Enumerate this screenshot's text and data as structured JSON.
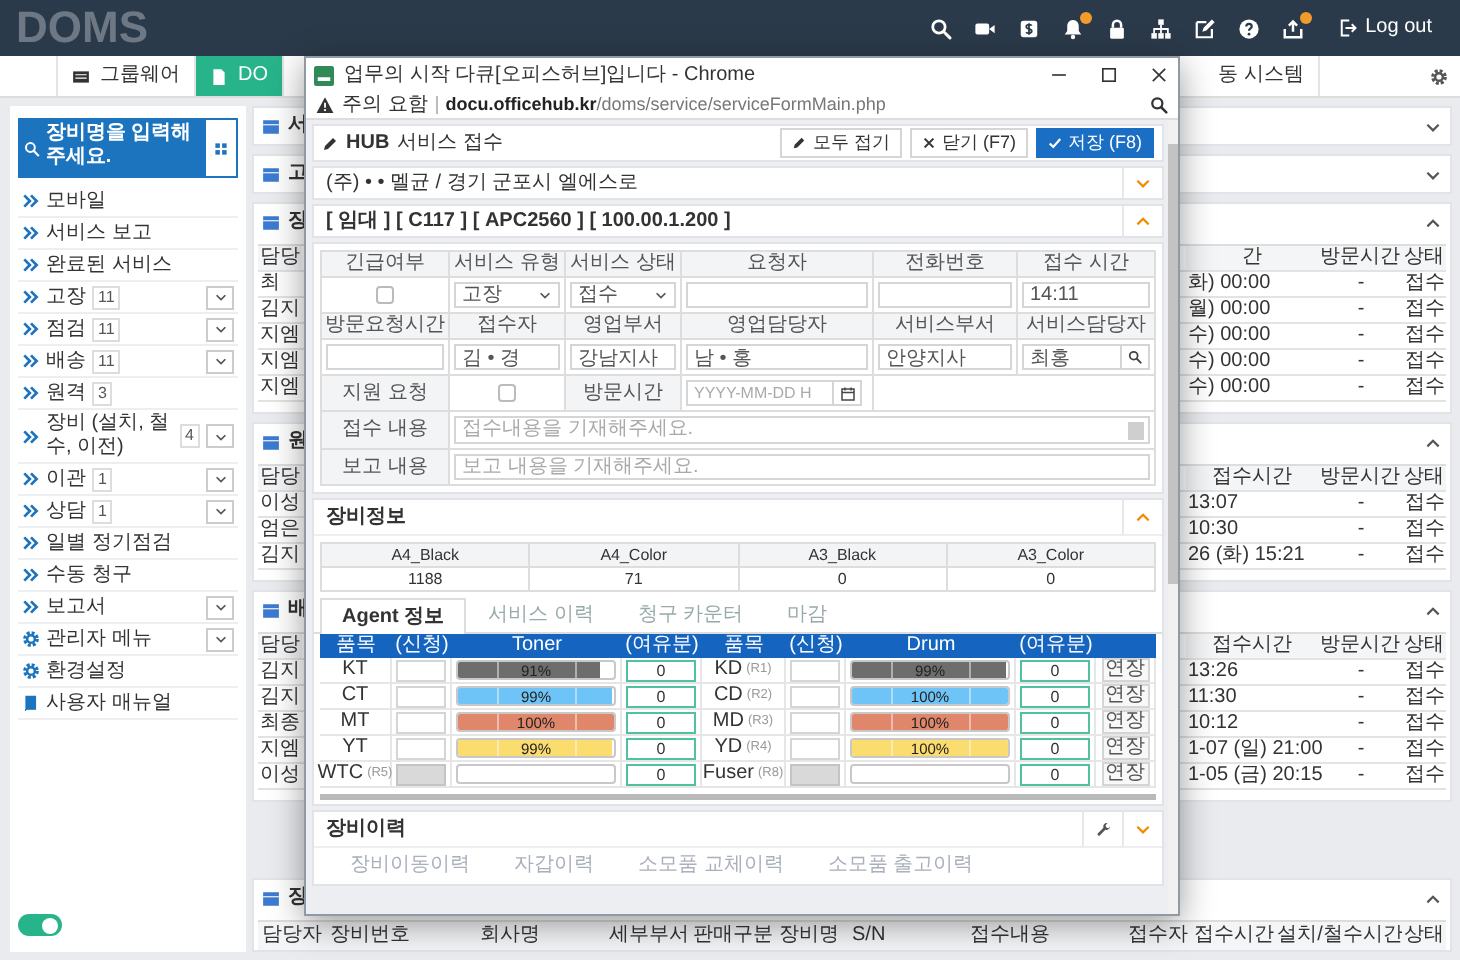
{
  "header": {
    "logo": "DOMS",
    "logout": "Log out"
  },
  "top_tabs": [
    {
      "label": "그룹웨어",
      "kind": "icon",
      "selected": false
    },
    {
      "label": "DO",
      "kind": "icon",
      "selected": true
    },
    {
      "label": "동 시스템",
      "kind": "plain",
      "selected": false
    }
  ],
  "sidebar": {
    "search": {
      "placeholder": "장비명을 입력해주세요."
    },
    "items": [
      {
        "kind": "nav",
        "label": "모바일",
        "expandable": false
      },
      {
        "kind": "nav",
        "label": "서비스 보고",
        "expandable": false
      },
      {
        "kind": "nav",
        "label": "완료된 서비스",
        "expandable": false
      },
      {
        "kind": "nav",
        "label": "고장",
        "count": "11",
        "expandable": true
      },
      {
        "kind": "nav",
        "label": "점검",
        "count": "11",
        "expandable": true
      },
      {
        "kind": "nav",
        "label": "배송",
        "count": "11",
        "expandable": true
      },
      {
        "kind": "nav",
        "label": "원격",
        "count": "3",
        "expandable": false
      },
      {
        "kind": "nav",
        "label": "장비 (설치, 철수, 이전)",
        "count": "4",
        "expandable": true
      },
      {
        "kind": "nav",
        "label": "이관",
        "count": "1",
        "expandable": true
      },
      {
        "kind": "nav",
        "label": "상담",
        "count": "1",
        "expandable": true
      },
      {
        "kind": "nav",
        "label": "일별 정기점검",
        "expandable": false
      },
      {
        "kind": "nav",
        "label": "수동 청구",
        "expandable": false
      },
      {
        "kind": "nav",
        "label": "보고서",
        "expandable": true
      },
      {
        "kind": "settings",
        "label": "관리자 메뉴",
        "expandable": true
      },
      {
        "kind": "settings",
        "label": "환경설정",
        "expandable": false
      },
      {
        "kind": "manual",
        "label": "사용자 매뉴얼",
        "expandable": false
      }
    ],
    "toggle": {
      "on": true
    }
  },
  "panels": [
    {
      "title": "서",
      "expanded": false
    },
    {
      "title": "고",
      "expanded": false
    },
    {
      "title": "장",
      "expanded": true,
      "table": {
        "kind": "split",
        "columns": [
          "담당",
          "간",
          "방문시간",
          "상태"
        ],
        "rows": [
          [
            "최",
            "화) 00:00",
            "-",
            "접수"
          ],
          [
            "김지",
            "월) 00:00",
            "-",
            "접수"
          ],
          [
            "지엠",
            "수) 00:00",
            "-",
            "접수"
          ],
          [
            "지엠",
            "수) 00:00",
            "-",
            "접수"
          ],
          [
            "지엠",
            "수) 00:00",
            "-",
            "접수"
          ]
        ]
      }
    },
    {
      "title": "원",
      "expanded": true,
      "table": {
        "kind": "split",
        "columns": [
          "담당",
          "접수시간",
          "방문시간",
          "상태"
        ],
        "rows": [
          [
            "이성",
            "13:07",
            "-",
            "접수"
          ],
          [
            "엄은",
            "10:30",
            "-",
            "접수"
          ],
          [
            "김지",
            "26 (화) 15:21",
            "-",
            "접수"
          ]
        ]
      }
    },
    {
      "title": "배",
      "expanded": true,
      "table": {
        "kind": "split",
        "columns": [
          "담당",
          "접수시간",
          "방문시간",
          "상태"
        ],
        "rows": [
          [
            "김지",
            "13:26",
            "-",
            "접수"
          ],
          [
            "김지",
            "11:30",
            "-",
            "접수"
          ],
          [
            "최종",
            "10:12",
            "-",
            "접수"
          ],
          [
            "지엠",
            "1-07 (일) 21:00",
            "-",
            "접수"
          ],
          [
            "이성",
            "1-05 (금) 20:15",
            "-",
            "접수"
          ]
        ]
      }
    },
    {
      "title": "장",
      "expanded": true,
      "table": {
        "kind": "full",
        "columns": [
          "담당자",
          "장비번호",
          "회사명",
          "세부부서",
          "판매구분",
          "장비명",
          "S/N",
          "접수내용",
          "접수자",
          "접수시간",
          "설치/철수시간",
          "상태"
        ]
      }
    }
  ],
  "popup": {
    "title": "업무의 시작 다큐[오피스허브]입니다 - Chrome",
    "security": "주의 요함",
    "url": "**docu.officehub.kr**/doms/service/serviceFormMain.php",
    "brand": "HUB",
    "heading": "서비스 접수",
    "buttons": [
      {
        "kind": "collapse",
        "label": "모두 접기"
      },
      {
        "kind": "close",
        "label": "닫기 (F7)"
      },
      {
        "kind": "save",
        "label": "저장 (F8)"
      }
    ],
    "customer": {
      "text": "(주) • • 멜균 / 경기 군포시 엘에스로",
      "expanded": false
    },
    "device": {
      "text": "[ 임대 ] [ C117 ] [ APC2560 ] [ 100.00.1.200 ]",
      "expanded": true
    },
    "form": [
      [
        {
          "kind": "label",
          "text": "긴급여부"
        },
        {
          "kind": "label",
          "text": "서비스 유형"
        },
        {
          "kind": "label",
          "text": "서비스 상태"
        },
        {
          "kind": "label",
          "text": "요청자"
        },
        {
          "kind": "label",
          "text": "전화번호"
        },
        {
          "kind": "label",
          "text": "접수 시간"
        }
      ],
      [
        {
          "kind": "checkbox",
          "checked": false
        },
        {
          "kind": "select",
          "value": "고장"
        },
        {
          "kind": "select",
          "value": "접수"
        },
        {
          "kind": "input"
        },
        {
          "kind": "input"
        },
        {
          "kind": "input",
          "value": "14:11"
        }
      ],
      [
        {
          "kind": "label",
          "text": "방문요청시간"
        },
        {
          "kind": "label",
          "text": "접수자"
        },
        {
          "kind": "label",
          "text": "영업부서"
        },
        {
          "kind": "label",
          "text": "영업담당자"
        },
        {
          "kind": "label",
          "text": "서비스부서"
        },
        {
          "kind": "label",
          "text": "서비스담당자"
        }
      ],
      [
        {
          "kind": "input"
        },
        {
          "kind": "input",
          "value": "김 • 경"
        },
        {
          "kind": "input",
          "value": "강남지사"
        },
        {
          "kind": "input",
          "value": "남 • 홍"
        },
        {
          "kind": "input",
          "value": "안양지사"
        },
        {
          "kind": "search",
          "value": "최홍"
        }
      ],
      [
        {
          "kind": "label",
          "text": "지원 요청"
        },
        {
          "kind": "checkbox",
          "checked": false
        },
        {
          "kind": "label",
          "text": "방문시간"
        },
        {
          "kind": "date",
          "placeholder": "YYYY-MM-DD H"
        },
        {
          "kind": "blank"
        }
      ],
      [
        {
          "kind": "label",
          "text": "접수 내용"
        },
        {
          "kind": "textarea",
          "placeholder": "접수내용을 기재해주세요."
        }
      ],
      [
        {
          "kind": "label",
          "text": "보고 내용"
        },
        {
          "kind": "input",
          "placeholder": "보고 내용을 기재해주세요."
        }
      ]
    ],
    "equipment": {
      "title": "장비정보",
      "expanded": true,
      "counters": [
        {
          "label": "A4_Black",
          "value": "1188"
        },
        {
          "label": "A4_Color",
          "value": "71"
        },
        {
          "label": "A3_Black",
          "value": "0"
        },
        {
          "label": "A3_Color",
          "value": "0"
        }
      ],
      "tabs": [
        {
          "label": "Agent 정보",
          "selected": true
        },
        {
          "label": "서비스 이력",
          "selected": false
        },
        {
          "label": "청구 카운터",
          "selected": false
        },
        {
          "label": "마감",
          "selected": false
        }
      ],
      "columns": [
        "품목",
        "(신청)",
        "Toner",
        "(여유분)",
        "품목",
        "(신청)",
        "Drum",
        "(여유분)"
      ],
      "rows": [
        {
          "toner": {
            "name": "KT",
            "disabled": false,
            "level": 0.91,
            "reading": "91%",
            "color": "#6d6d6d",
            "spare": "0"
          },
          "drum": {
            "name": "KD",
            "code": "(R1)",
            "disabled": false,
            "level": 0.99,
            "reading": "99%",
            "color": "#6d6d6d",
            "spare": "0",
            "action": "연장"
          }
        },
        {
          "toner": {
            "name": "CT",
            "disabled": false,
            "level": 0.99,
            "reading": "99%",
            "color": "#6ec3f7",
            "spare": "0"
          },
          "drum": {
            "name": "CD",
            "code": "(R2)",
            "disabled": false,
            "level": 1,
            "reading": "100%",
            "color": "#6ec3f7",
            "spare": "0",
            "action": "연장"
          }
        },
        {
          "toner": {
            "name": "MT",
            "disabled": false,
            "level": 1,
            "reading": "100%",
            "color": "#e0876b",
            "spare": "0"
          },
          "drum": {
            "name": "MD",
            "code": "(R3)",
            "disabled": false,
            "level": 1,
            "reading": "100%",
            "color": "#e0876b",
            "spare": "0",
            "action": "연장"
          }
        },
        {
          "toner": {
            "name": "YT",
            "disabled": false,
            "level": 0.99,
            "reading": "99%",
            "color": "#fbdc6e",
            "spare": "0"
          },
          "drum": {
            "name": "YD",
            "code": "(R4)",
            "disabled": false,
            "level": 1,
            "reading": "100%",
            "color": "#fbdc6e",
            "spare": "0",
            "action": "연장"
          }
        },
        {
          "toner": {
            "name": "WTC",
            "code": "(R5)",
            "disabled": true,
            "spare": "0"
          },
          "drum": {
            "name": "Fuser",
            "code": "(R8)",
            "disabled": true,
            "spare": "0",
            "action": "연장"
          }
        }
      ]
    },
    "history": {
      "title": "장비이력",
      "expanded": false,
      "tabs": [
        {
          "label": "장비이동이력",
          "selected": false
        },
        {
          "label": "자갑이력",
          "selected": false
        },
        {
          "label": "소모품 교체이력",
          "selected": false
        },
        {
          "label": "소모품 출고이력",
          "selected": false
        }
      ]
    }
  }
}
